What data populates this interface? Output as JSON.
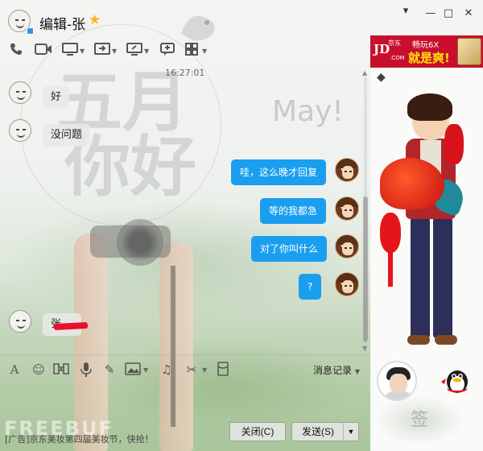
{
  "window": {
    "contact_name": "编辑-张",
    "min_glyph": "—",
    "max_glyph": "□",
    "close_glyph": "✕",
    "collapse_glyph": "▾"
  },
  "background": {
    "deco_line1": "五月",
    "deco_line2": "你好",
    "deco_may": "May!"
  },
  "chat": {
    "timestamp": "16:27:01",
    "messages": [
      {
        "side": "left",
        "text": "好"
      },
      {
        "side": "left",
        "text": "没问题"
      },
      {
        "side": "right",
        "text": "哇，这么晚才回复"
      },
      {
        "side": "right",
        "text": "等的我都急"
      },
      {
        "side": "right",
        "text": "对了你叫什么"
      },
      {
        "side": "right",
        "text": "?"
      },
      {
        "side": "left",
        "text": "张"
      }
    ]
  },
  "input_toolbar": {
    "history_label": "消息记录"
  },
  "footer": {
    "ad_text": "[广告]京东美妆第四届美妆节，快抢！",
    "close_button": "关闭(C)",
    "send_button": "发送(S)",
    "watermark": "FREEBUF"
  },
  "right_panel": {
    "ad_brand": "JD",
    "ad_brand_sub": "京东",
    "ad_brand_sub2": ".COM",
    "ad_line1": "畅玩6X",
    "ad_line2": "就是爽!",
    "deco_sign": "签"
  },
  "colors": {
    "bubble_right": "#1a9ef0",
    "star": "#f3b813",
    "ad_red": "#c8102e"
  }
}
